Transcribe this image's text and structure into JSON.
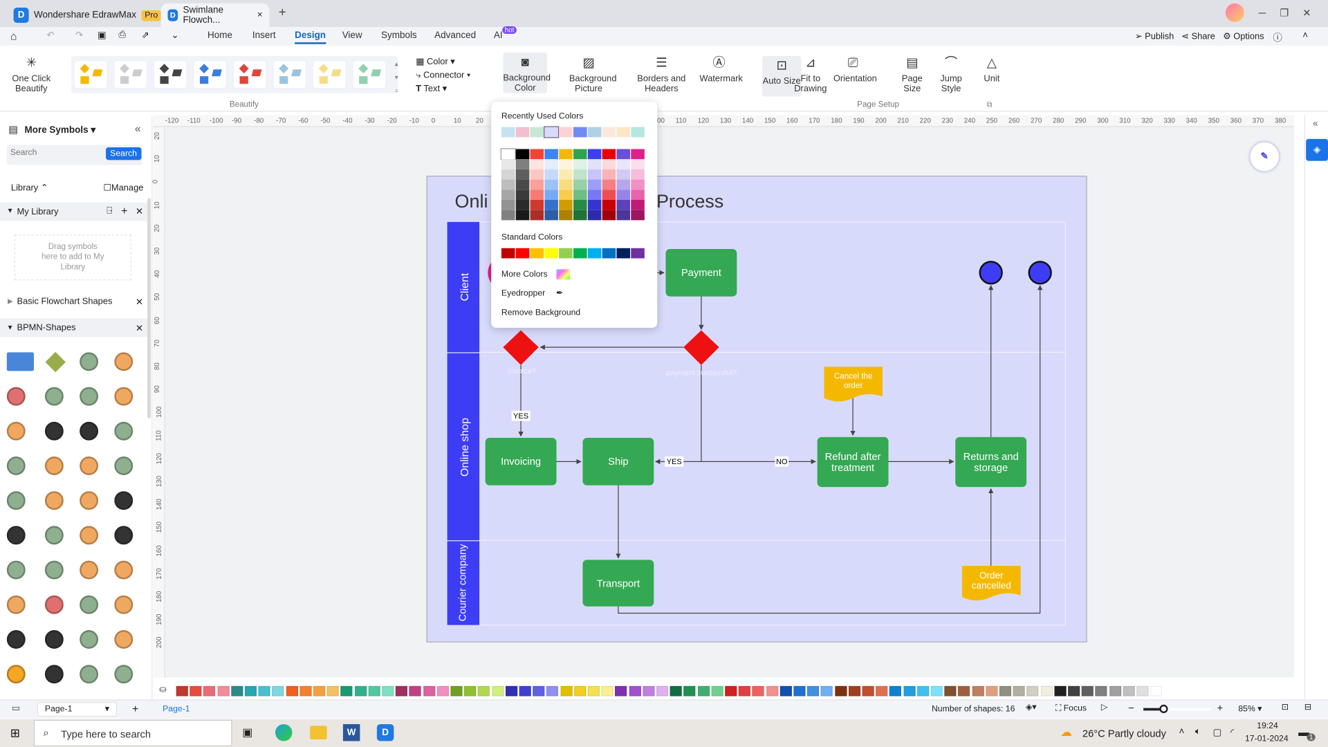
{
  "app": {
    "name": "Wondershare EdrawMax",
    "badge": "Pro",
    "doc_tab": "Swimlane Flowch...",
    "new_tab": "+",
    "close_tab": "×"
  },
  "menu": {
    "items": [
      "Home",
      "Insert",
      "Design",
      "View",
      "Symbols",
      "Advanced",
      "AI"
    ],
    "active": "Design",
    "ai_badge": "hot",
    "publish": "Publish",
    "share": "Share",
    "options": "Options"
  },
  "ribbon": {
    "one_click": "One Click Beautify",
    "beautify_group": "Beautify",
    "color": "Color",
    "connector": "Connector",
    "text": "Text",
    "buttons": [
      {
        "label": "Background Color",
        "icon": "background-color-icon"
      },
      {
        "label": "Background Picture",
        "icon": "background-picture-icon"
      },
      {
        "label": "Borders and Headers",
        "icon": "borders-headers-icon"
      },
      {
        "label": "Watermark",
        "icon": "watermark-icon"
      },
      {
        "label": "Auto Size",
        "icon": "auto-size-icon"
      },
      {
        "label": "Fit to Drawing",
        "icon": "fit-to-drawing-icon"
      },
      {
        "label": "Orientation",
        "icon": "orientation-icon"
      },
      {
        "label": "Page Size",
        "icon": "page-size-icon"
      },
      {
        "label": "Jump Style",
        "icon": "jump-style-icon"
      },
      {
        "label": "Unit",
        "icon": "unit-icon"
      }
    ],
    "page_setup_group": "Page Setup",
    "theme_colors": [
      "#f5b800",
      "#cccccc",
      "#444444",
      "#3b7de0",
      "#e0453a",
      "#9cc3e0",
      "#f5dd88",
      "#8fd0b0"
    ]
  },
  "sidebar": {
    "title": "More Symbols",
    "search_placeholder": "Search",
    "search_button": "Search",
    "library": "Library",
    "manage": "Manage",
    "my_library": "My Library",
    "drop_hint": "Drag symbols here to add to My Library",
    "sections": [
      "Basic Flowchart Shapes",
      "BPMN-Shapes"
    ],
    "shape_colors": [
      "#4a86d8",
      "#9aab4c",
      "#8fb08f",
      "#f0a860",
      "#e07070",
      "#8fb08f",
      "#8fb08f",
      "#f0a860",
      "#f0a860",
      "#333333",
      "#333333",
      "#8fb08f",
      "#8fb08f",
      "#f0a860",
      "#f0a860",
      "#8fb08f",
      "#8fb08f",
      "#f0a860",
      "#f0a860",
      "#333333",
      "#333333",
      "#8fb08f",
      "#f0a860",
      "#333333",
      "#8fb08f",
      "#8fb08f",
      "#f0a860",
      "#f0a860",
      "#f0a860",
      "#e07070",
      "#8fb08f",
      "#f0a860",
      "#333333",
      "#333333",
      "#8fb08f",
      "#f0a860",
      "#f5a623",
      "#333333",
      "#8fb08f",
      "#8fb08f"
    ]
  },
  "ruler": {
    "top": [
      "-120",
      "-110",
      "-100",
      "-90",
      "-80",
      "-70",
      "-60",
      "-50",
      "-40",
      "-30",
      "-20",
      "-10",
      "0",
      "10",
      "20",
      "30",
      "40",
      "50",
      "60",
      "70",
      "80",
      "90",
      "100",
      "110",
      "120",
      "130",
      "140",
      "150",
      "160",
      "170",
      "180",
      "190",
      "200",
      "210",
      "220",
      "230",
      "240",
      "250",
      "260",
      "270",
      "280",
      "290",
      "300",
      "310",
      "320",
      "330",
      "340",
      "350",
      "360",
      "370",
      "380"
    ],
    "left": [
      "20",
      "10",
      "0",
      "10",
      "20",
      "30",
      "40",
      "50",
      "60",
      "70",
      "80",
      "90",
      "100",
      "110",
      "120",
      "130",
      "140",
      "150",
      "160",
      "170",
      "180",
      "190",
      "200"
    ]
  },
  "diagram": {
    "title_left": "Onli",
    "title_right": "Process",
    "lanes": [
      "Client",
      "Online shop",
      "Courier company"
    ],
    "nodes": {
      "payment": "Payment",
      "invoicing": "Invoicing",
      "ship": "Ship",
      "refund": "Refund after treatment",
      "returns": "Returns and storage",
      "transport": "Transport",
      "cancel": "Cancel the order",
      "cancelled": "Order cancelled"
    },
    "labels": {
      "invoice_q": "Invoice?",
      "payment_q": "payment successful?",
      "yes1": "YES",
      "yes2": "YES",
      "no": "NO"
    },
    "colors": {
      "page": "#d8dafb",
      "lane_header": "#3d3df5",
      "task": "#34a853",
      "decision": "#ee1111",
      "note": "#f5b800",
      "end": "#3d3df5",
      "start": "#e0208a"
    }
  },
  "popup": {
    "recent_title": "Recently Used Colors",
    "recent": [
      "#c6e2f0",
      "#f2c0cc",
      "#c8e6d4",
      "#d8dafb",
      "#fcd3d3",
      "#6f8cf5",
      "#b0d0e6",
      "#fbe8dc",
      "#fde6c8",
      "#b6e6e0"
    ],
    "base": [
      "#ffffff",
      "#000000",
      "#f44336",
      "#3d85f0",
      "#f5b800",
      "#2ea44f",
      "#3d3df5",
      "#e8000b",
      "#6a4fdb",
      "#e0208a"
    ],
    "standard_title": "Standard Colors",
    "standard": [
      "#c00000",
      "#ff0000",
      "#ffc000",
      "#ffff00",
      "#92d050",
      "#00b050",
      "#00b0f0",
      "#0070c0",
      "#002060",
      "#7030a0"
    ],
    "more_colors": "More Colors",
    "eyedropper": "Eyedropper",
    "remove_background": "Remove Background"
  },
  "palette": [
    "#c0392b",
    "#e74c3c",
    "#ec6a7a",
    "#f28b9b",
    "#2d8a8a",
    "#2aa6b0",
    "#48c0d0",
    "#7dd8e0",
    "#f06020",
    "#f58030",
    "#f5a040",
    "#f5c060",
    "#1a9a70",
    "#30b090",
    "#50c8a0",
    "#80e0c0",
    "#a03060",
    "#c04080",
    "#e060a0",
    "#f090c0",
    "#70a020",
    "#90c030",
    "#b0d850",
    "#d0f080",
    "#3030b0",
    "#4040d0",
    "#6060e0",
    "#9090f0",
    "#e0c000",
    "#f0d020",
    "#f5e050",
    "#faf090",
    "#8030b0",
    "#a050d0",
    "#c080e0",
    "#e0b0f0",
    "#107040",
    "#209050",
    "#40b070",
    "#70d090",
    "#d02020",
    "#e04040",
    "#f06060",
    "#f09090",
    "#1050b0",
    "#2070d0",
    "#4090e0",
    "#70b0f0",
    "#803010",
    "#a04020",
    "#c05030",
    "#e07050",
    "#1080d0",
    "#20a0e0",
    "#40c0f0",
    "#80e0ff",
    "#805030",
    "#a06040",
    "#c08060",
    "#e0a080",
    "#909080",
    "#b0b0a0",
    "#d0d0c0",
    "#f0f0e0",
    "#202020",
    "#404040",
    "#606060",
    "#808080",
    "#a0a0a0",
    "#c0c0c0",
    "#e0e0e0",
    "#ffffff"
  ],
  "status": {
    "page_tab": "Page-1",
    "page_select": "Page-1",
    "shapes": "Number of shapes: 16",
    "focus": "Focus",
    "zoom": "85%",
    "zoom_level": 0.3
  },
  "taskbar": {
    "search": "Type here to search",
    "weather": "26°C  Partly cloudy",
    "time": "19:24",
    "date": "17-01-2024",
    "notif": "1"
  }
}
